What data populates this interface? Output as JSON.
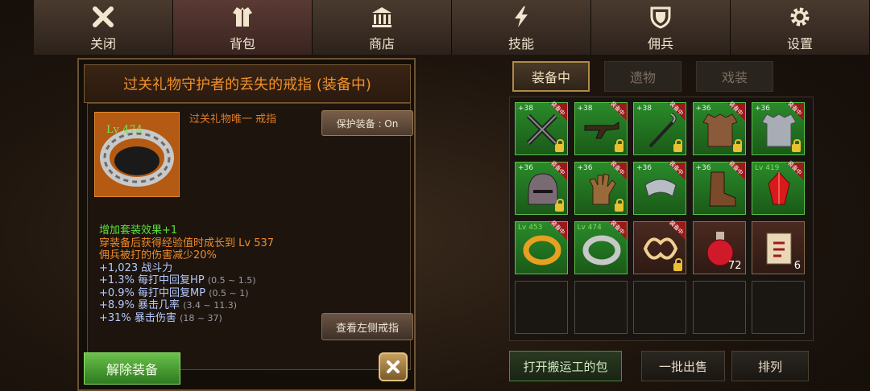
{
  "nav": [
    {
      "label": "关闭",
      "icon": "close-icon"
    },
    {
      "label": "背包",
      "icon": "armor-icon"
    },
    {
      "label": "商店",
      "icon": "shop-icon"
    },
    {
      "label": "技能",
      "icon": "lightning-icon"
    },
    {
      "label": "佣兵",
      "icon": "shield-icon"
    },
    {
      "label": "设置",
      "icon": "gear-icon"
    }
  ],
  "item": {
    "title": "过关礼物守护者的丢失的戒指 (装备中)",
    "level": "Lv 474",
    "subtitle": "过关礼物唯一 戒指",
    "protect_button": "保护装备 : On",
    "stats": {
      "set_effect": "增加套装效果+1",
      "growth": "穿装备后获得经验值时成长到 Lv 537",
      "damage_reduction_prefix": "佣兵被打的伤害减少",
      "damage_reduction_value": "20%",
      "power": "+1,023 战斗力",
      "hp_regen": "+1.3% 每打中回复HP",
      "hp_regen_range": "(0.5 ~ 1.5)",
      "mp_regen": "+0.9% 每打中回复MP",
      "mp_regen_range": "(0.5 ~ 1)",
      "crit_rate": "+8.9% 暴击几率",
      "crit_rate_range": "(3.4 ~ 11.3)",
      "crit_damage": "+31% 暴击伤害",
      "crit_damage_range": "(18 ~ 37)"
    },
    "view_left_ring": "查看左侧戒指",
    "unequip": "解除装备"
  },
  "tabs": [
    "装备中",
    "遗物",
    "戏装"
  ],
  "equipped_tag": "装备中",
  "slots": [
    {
      "type": "green",
      "plus": "+38",
      "equipped": true,
      "locked": true,
      "icon": "crossed-swords-icon"
    },
    {
      "type": "green",
      "plus": "+38",
      "equipped": true,
      "locked": true,
      "icon": "rifle-icon"
    },
    {
      "type": "green",
      "plus": "+38",
      "equipped": true,
      "locked": true,
      "icon": "staff-icon"
    },
    {
      "type": "green",
      "plus": "+36",
      "equipped": true,
      "locked": true,
      "icon": "leather-armor-icon"
    },
    {
      "type": "green",
      "plus": "+36",
      "equipped": true,
      "locked": true,
      "icon": "plate-armor-icon"
    },
    {
      "type": "green",
      "plus": "+36",
      "equipped": true,
      "locked": true,
      "icon": "helmet-icon"
    },
    {
      "type": "green",
      "plus": "+36",
      "equipped": true,
      "locked": true,
      "icon": "gloves-icon"
    },
    {
      "type": "green",
      "plus": "+36",
      "equipped": true,
      "locked": false,
      "icon": "bracer-icon"
    },
    {
      "type": "green",
      "plus": "+36",
      "equipped": true,
      "locked": false,
      "icon": "boots-icon"
    },
    {
      "type": "green",
      "level": "Lv 419",
      "equipped": true,
      "locked": false,
      "icon": "red-gem-icon"
    },
    {
      "type": "green",
      "level": "Lv 453",
      "equipped": true,
      "locked": false,
      "icon": "gold-ring-icon"
    },
    {
      "type": "green",
      "level": "Lv 474",
      "equipped": true,
      "locked": false,
      "icon": "silver-ring-icon"
    },
    {
      "type": "brown",
      "equipped": true,
      "locked": true,
      "icon": "emblem-icon"
    },
    {
      "type": "brown",
      "count": "72",
      "icon": "potion-icon"
    },
    {
      "type": "brown",
      "count": "6",
      "icon": "scroll-icon"
    },
    {
      "type": "empty"
    },
    {
      "type": "empty"
    },
    {
      "type": "empty"
    },
    {
      "type": "empty"
    },
    {
      "type": "empty"
    }
  ],
  "bottom": {
    "open_porter_bag": "打开搬运工的包",
    "bulk_sell": "一批出售",
    "sort": "排列"
  }
}
